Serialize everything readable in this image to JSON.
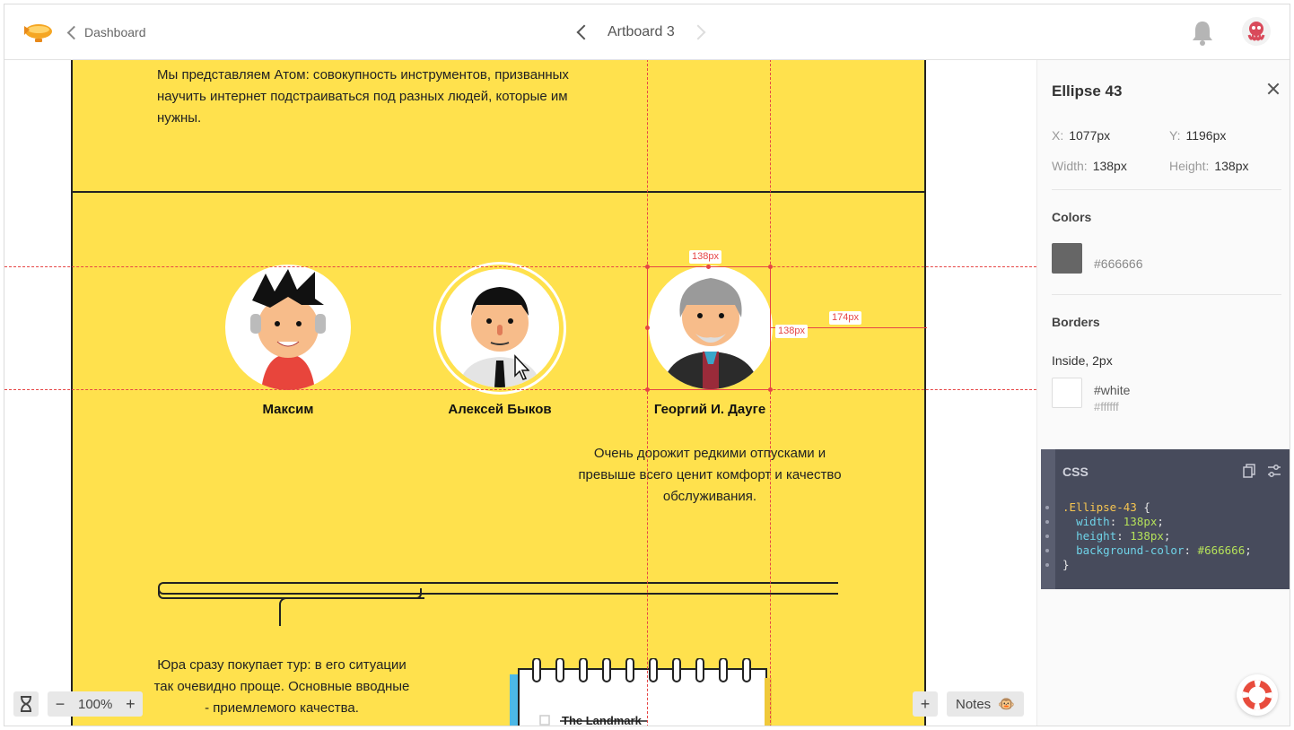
{
  "header": {
    "back_label": "Dashboard",
    "artboard_title": "Artboard 3"
  },
  "artboard": {
    "intro_text": "Мы представляем Атом: совокупность инструментов, призванных научить интернет подстраиваться под разных людей, которые им нужны.",
    "people": [
      {
        "name": "Максим"
      },
      {
        "name": "Алексей Быков"
      },
      {
        "name": "Георгий И. Дауге"
      }
    ],
    "quote": "Очень дорожит редкими отпусками и превыше всего ценит комфорт и качество обслуживания.",
    "bottom_text": "Юра сразу покупает тур: в его ситуации так очевидно проще. Основные вводные - приемлемого качества.",
    "notebook_text": "The Landmark"
  },
  "measurements": {
    "width_label": "138px",
    "height_label": "138px",
    "distance_label": "174px"
  },
  "canvas_controls": {
    "zoom": "100%",
    "notes_label": "Notes",
    "notes_emoji": "🐵"
  },
  "inspector": {
    "title": "Ellipse 43",
    "x_key": "X:",
    "x_val": "1077px",
    "y_key": "Y:",
    "y_val": "1196px",
    "w_key": "Width:",
    "w_val": "138px",
    "h_key": "Height:",
    "h_val": "138px",
    "colors_heading": "Colors",
    "fill_color": "#666666",
    "fill_color_label": "#666666",
    "borders_heading": "Borders",
    "border_desc": "Inside, 2px",
    "border_color_name": "#white",
    "border_color_hex": "#ffffff",
    "css_heading": "CSS",
    "css_lines": {
      "l1_sel": ".Ellipse-43",
      "l1_rest": " {",
      "l2_prop": "width",
      "l2_val": "138px",
      "l3_prop": "height",
      "l3_val": "138px",
      "l4_prop": "background-color",
      "l4_val": "#666666",
      "l5": "}"
    }
  },
  "icons": [
    "zeppelin-logo-icon",
    "chevron-left-icon",
    "chevron-right-icon",
    "bell-icon",
    "user-avatar-icon",
    "close-icon",
    "hourglass-icon",
    "plus-icon",
    "minus-icon",
    "copy-icon",
    "settings-sliders-icon",
    "lifebuoy-icon"
  ]
}
